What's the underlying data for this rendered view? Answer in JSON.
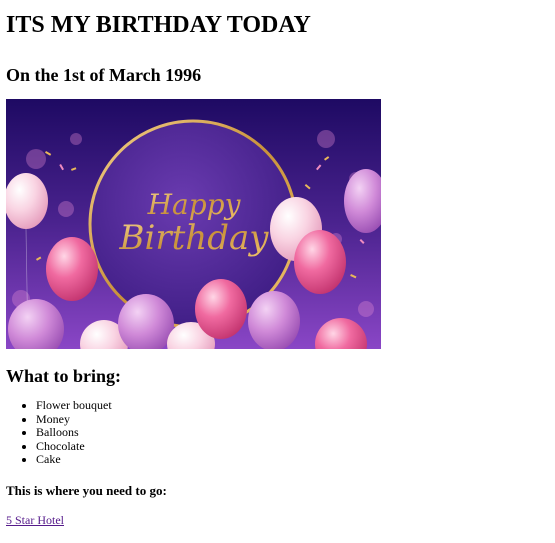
{
  "heading": "ITS MY BIRTHDAY TODAY",
  "subheading": "On the 1st of March 1996",
  "banner": {
    "text_line1": "Happy",
    "text_line2": "Birthday",
    "bg_top": "#2a0f6e",
    "bg_bottom": "#7a3cc0",
    "ring_color": "#c9923a",
    "balloon_pink": "#f06aa0",
    "balloon_light": "#f7c6da"
  },
  "bring": {
    "title": "What to bring:",
    "items": [
      "Flower bouquet",
      "Money",
      "Balloons",
      "Chocolate",
      "Cake"
    ]
  },
  "location": {
    "title": "This is where you need to go:",
    "link_text": "5 Star Hotel",
    "link_color": "#551a8b"
  }
}
